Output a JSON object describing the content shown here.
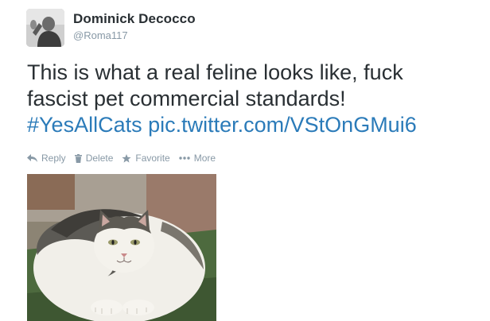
{
  "user": {
    "fullname": "Dominick Decocco",
    "handle": "@Roma117"
  },
  "tweet": {
    "text_line1": "This is what a real feline looks like, fuck",
    "text_line2": "fascist pet commercial standards!",
    "hashtag": "#YesAllCats",
    "link": "pic.twitter.com/VStOnGMui6"
  },
  "actions": {
    "reply": "Reply",
    "delete": "Delete",
    "favorite": "Favorite",
    "more": "More"
  },
  "icons": {
    "reply": "reply-arrow-icon",
    "delete": "trash-icon",
    "favorite": "star-icon",
    "more": "ellipsis-icon"
  },
  "colors": {
    "link": "#2b7bb9",
    "muted": "#8899a6",
    "text": "#292f33"
  }
}
